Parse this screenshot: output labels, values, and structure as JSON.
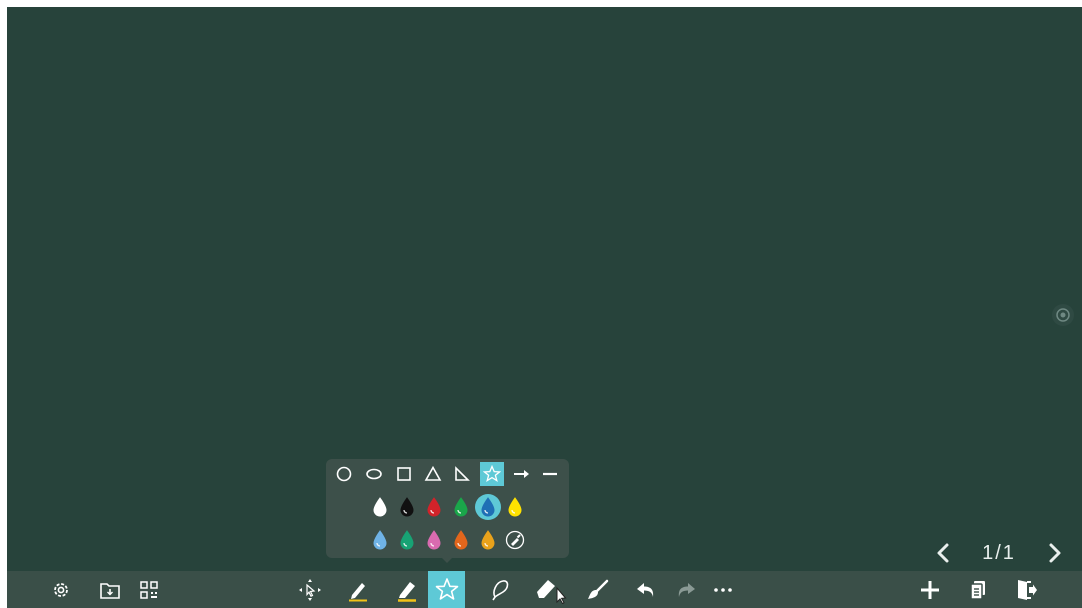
{
  "pager": {
    "page": "1/1"
  },
  "toolbar": {
    "left": [
      "gear-icon",
      "folder-download-icon",
      "qr-code-icon"
    ],
    "center": [
      "move-select-icon",
      "pen-icon",
      "highlighter-icon",
      "star-shape-icon",
      "lasso-icon",
      "eraser-icon",
      "brush-icon",
      "undo-icon",
      "redo-icon",
      "more-icon"
    ],
    "right": [
      "add-page-icon",
      "pages-icon",
      "exit-icon"
    ],
    "active": "star-shape-icon"
  },
  "shape_popup": {
    "shapes": [
      "circle",
      "ellipse",
      "square",
      "triangle",
      "right-triangle",
      "star",
      "arrow",
      "line"
    ],
    "active_shape": "star",
    "colors_row1": [
      "#ffffff",
      "#111111",
      "#d2232a",
      "#1aa64a",
      "#1f6fb5",
      "#ffe200"
    ],
    "colors_row2": [
      "#6fb3e6",
      "#17a374",
      "#d96bb0",
      "#e2661c",
      "#e9a21b"
    ],
    "active_color": "#1f6fb5",
    "custom_color": "color-picker-icon"
  },
  "colors": {
    "board": "#27433b",
    "toolbar": "#3a4f48",
    "accent": "#5ec9d6",
    "popup": "#3d504a"
  }
}
